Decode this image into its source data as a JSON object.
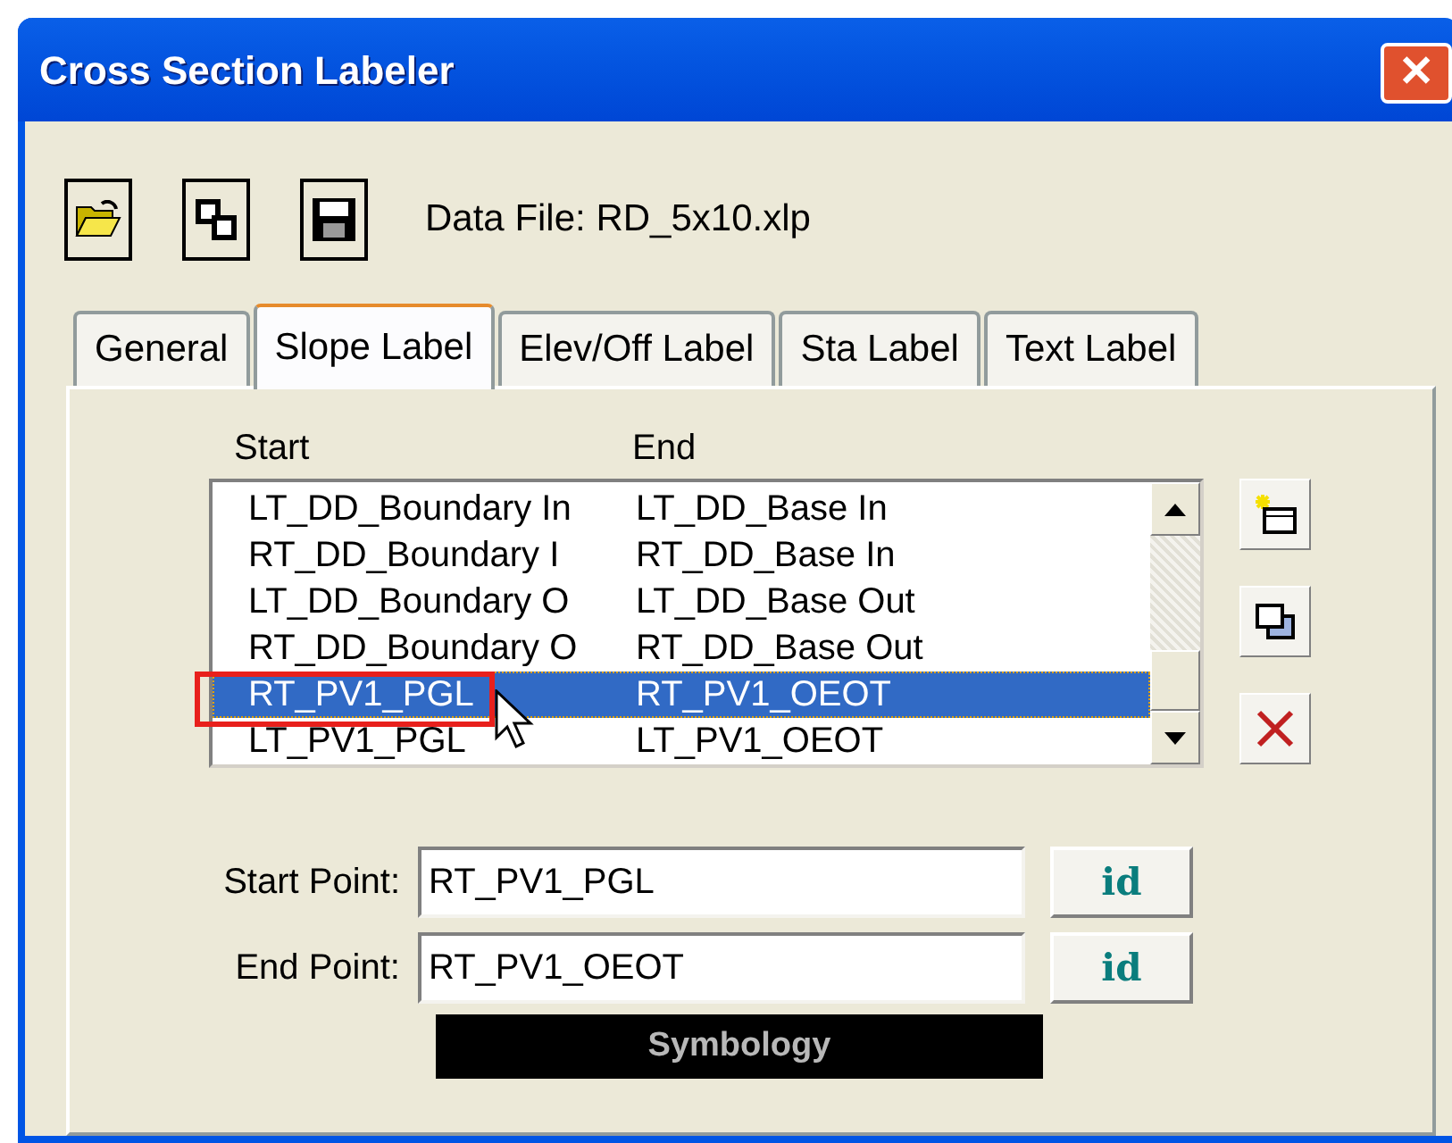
{
  "window": {
    "title": "Cross Section Labeler",
    "close": "✕"
  },
  "data_file": "Data File: RD_5x10.xlp",
  "tabs": [
    {
      "label": "General",
      "selected": false
    },
    {
      "label": "Slope Label",
      "selected": true
    },
    {
      "label": "Elev/Off Label",
      "selected": false
    },
    {
      "label": "Sta Label",
      "selected": false
    },
    {
      "label": "Text Label",
      "selected": false
    }
  ],
  "list": {
    "columns": [
      "Start",
      "End"
    ],
    "rows": [
      {
        "start": "LT_DD_Boundary In",
        "end": "LT_DD_Base In",
        "selected": false
      },
      {
        "start": "RT_DD_Boundary I",
        "end": "RT_DD_Base In",
        "selected": false
      },
      {
        "start": "LT_DD_Boundary O",
        "end": "LT_DD_Base Out",
        "selected": false
      },
      {
        "start": "RT_DD_Boundary O",
        "end": "RT_DD_Base Out",
        "selected": false
      },
      {
        "start": "RT_PV1_PGL",
        "end": "RT_PV1_OEOT",
        "selected": true
      },
      {
        "start": "LT_PV1_PGL",
        "end": "LT_PV1_OEOT",
        "selected": false
      }
    ]
  },
  "fields": [
    {
      "label": "Start Point:",
      "value": "RT_PV1_PGL",
      "button": "id"
    },
    {
      "label": "End Point:",
      "value": "RT_PV1_OEOT",
      "button": "id"
    }
  ],
  "symbology_button": "Symbology"
}
